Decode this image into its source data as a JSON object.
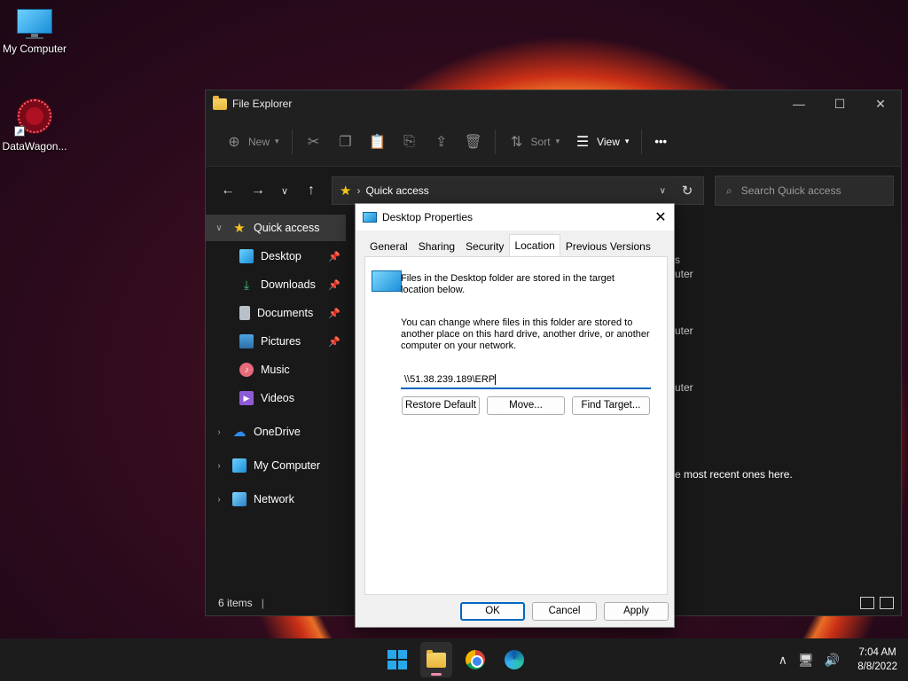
{
  "desktop": {
    "icons": [
      {
        "label": "My Computer"
      },
      {
        "label": "DataWagon..."
      }
    ]
  },
  "explorer": {
    "title": "File Explorer",
    "toolbar": {
      "new_label": "New",
      "sort_label": "Sort",
      "view_label": "View",
      "more_label": "•••"
    },
    "address": {
      "location": "Quick access",
      "search_placeholder": "Search Quick access"
    },
    "sidebar": {
      "quick_access": "Quick access",
      "items": [
        {
          "label": "Desktop",
          "pinned": true
        },
        {
          "label": "Downloads",
          "pinned": true
        },
        {
          "label": "Documents",
          "pinned": true
        },
        {
          "label": "Pictures",
          "pinned": true
        },
        {
          "label": "Music"
        },
        {
          "label": "Videos"
        }
      ],
      "onedrive": "OneDrive",
      "my_computer": "My Computer",
      "network": "Network"
    },
    "content": {
      "fragment_1": "s",
      "fragment_2": "uter",
      "fragment_3": "uter",
      "fragment_4": "uter",
      "recent_fragment": "e most recent ones here."
    },
    "status": {
      "items_count": "6 items"
    }
  },
  "dialog": {
    "title": "Desktop Properties",
    "tabs": [
      "General",
      "Sharing",
      "Security",
      "Location",
      "Previous Versions"
    ],
    "selected_tab": "Location",
    "info_line1": "Files in the Desktop folder are stored in the target",
    "info_line2": "location below.",
    "change_line1": "You can change where files in this folder are stored to",
    "change_line2": "another place on this hard drive, another drive, or another",
    "change_line3": "computer on your network.",
    "path_value": "\\\\51.38.239.189\\ERP",
    "buttons": {
      "restore_default": "Restore Default",
      "move": "Move...",
      "find_target": "Find Target...",
      "ok": "OK",
      "cancel": "Cancel",
      "apply": "Apply"
    }
  },
  "taskbar": {
    "time": "7:04 AM",
    "date": "8/8/2022"
  }
}
